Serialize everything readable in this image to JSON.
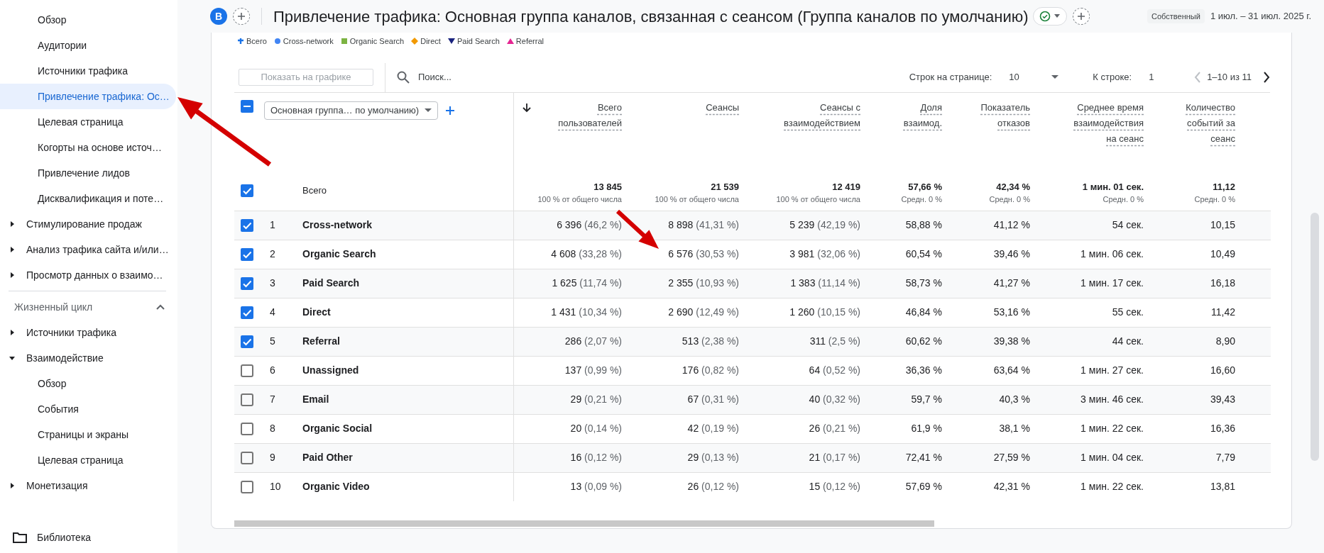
{
  "sidebar": {
    "items": [
      {
        "kind": "leaf",
        "label": "Обзор",
        "selected": false
      },
      {
        "kind": "leaf",
        "label": "Аудитории",
        "selected": false
      },
      {
        "kind": "leaf",
        "label": "Источники трафика",
        "selected": false
      },
      {
        "kind": "leaf",
        "label": "Привлечение трафика: Ос…",
        "selected": true
      },
      {
        "kind": "leaf",
        "label": "Целевая страница",
        "selected": false
      },
      {
        "kind": "leaf",
        "label": "Когорты на основе источ…",
        "selected": false
      },
      {
        "kind": "leaf",
        "label": "Привлечение лидов",
        "selected": false
      },
      {
        "kind": "leaf",
        "label": "Дисквалификация и поте…",
        "selected": false
      },
      {
        "kind": "group",
        "label": "Стимулирование продаж",
        "selected": false,
        "expanded": false
      },
      {
        "kind": "group",
        "label": "Анализ трафика сайта и/или…",
        "selected": false,
        "expanded": false
      },
      {
        "kind": "group",
        "label": "Просмотр данных о взаимо…",
        "selected": false,
        "expanded": false
      },
      {
        "kind": "section",
        "label": "Жизненный цикл",
        "selected": false,
        "expanded": true,
        "children": [
          {
            "kind": "group",
            "label": "Источники трафика",
            "selected": false,
            "expanded": false
          },
          {
            "kind": "group",
            "label": "Взаимодействие",
            "selected": false,
            "expanded": true,
            "children": [
              {
                "kind": "leaf",
                "label": "Обзор",
                "selected": false
              },
              {
                "kind": "leaf",
                "label": "События",
                "selected": false
              },
              {
                "kind": "leaf",
                "label": "Страницы и экраны",
                "selected": false
              },
              {
                "kind": "leaf",
                "label": "Целевая страница",
                "selected": false
              }
            ]
          },
          {
            "kind": "group",
            "label": "Монетизация",
            "selected": false,
            "expanded": false
          }
        ]
      }
    ],
    "footer": {
      "label": "Библиотека"
    }
  },
  "header": {
    "avatar": "B",
    "title": "Привлечение трафика: Основная группа каналов, связанная с сеансом (Группа каналов по умолчанию)",
    "badge": "Собственный",
    "date_range": "1 июл. – 31 июл. 2025 г."
  },
  "legend": [
    {
      "label": "Всего",
      "kind": "pin",
      "color": "#1a73e8"
    },
    {
      "label": "Cross-network",
      "kind": "circle",
      "color": "#4285f4"
    },
    {
      "label": "Organic Search",
      "kind": "square",
      "color": "#7cb342"
    },
    {
      "label": "Direct",
      "kind": "diamond",
      "color": "#f29900"
    },
    {
      "label": "Paid Search",
      "kind": "triangle-down",
      "color": "#1a237e"
    },
    {
      "label": "Referral",
      "kind": "triangle-up",
      "color": "#e52592"
    }
  ],
  "toolbar": {
    "plot_button": {
      "label": "Показать на графике",
      "disabled": true
    },
    "search": {
      "placeholder": "Поиск..."
    },
    "rows_per_page_label": "Строк на странице:",
    "rows_per_page": "10",
    "goto_label": "К строке:",
    "goto_value": "1",
    "range": "1–10 из 11",
    "prev_disabled": true,
    "next_disabled": false
  },
  "table": {
    "header_checkbox": {
      "indeterminate": true
    },
    "dimension": "Основная группа… по умолчанию)",
    "columns": [
      "Всего пользователей",
      "Сеансы",
      "Сеансы с взаимодействием",
      "Доля взаимод.",
      "Показатель отказов",
      "Среднее время взаимодействия на сеанс",
      "Количество событий за сеанс"
    ],
    "totals": {
      "label": "Всего",
      "checked": true,
      "cells": [
        {
          "value": "13 845",
          "note": "100 % от общего числа"
        },
        {
          "value": "21 539",
          "note": "100 % от общего числа"
        },
        {
          "value": "12 419",
          "note": "100 % от общего числа"
        },
        {
          "value": "57,66 %",
          "note": "Средн. 0 %"
        },
        {
          "value": "42,34 %",
          "note": "Средн. 0 %"
        },
        {
          "value": "1 мин. 01 сек.",
          "note": "Средн. 0 %"
        },
        {
          "value": "11,12",
          "note": "Средн. 0 %"
        }
      ]
    },
    "rows": [
      {
        "n": "1",
        "channel": "Cross-network",
        "checked": true,
        "cells": [
          {
            "value": "6 396",
            "share": "(46,2 %)"
          },
          {
            "value": "8 898",
            "share": "(41,31 %)"
          },
          {
            "value": "5 239",
            "share": "(42,19 %)"
          },
          {
            "value": "58,88 %"
          },
          {
            "value": "41,12 %"
          },
          {
            "value": "54 сек."
          },
          {
            "value": "10,15"
          }
        ]
      },
      {
        "n": "2",
        "channel": "Organic Search",
        "checked": true,
        "cells": [
          {
            "value": "4 608",
            "share": "(33,28 %)"
          },
          {
            "value": "6 576",
            "share": "(30,53 %)"
          },
          {
            "value": "3 981",
            "share": "(32,06 %)"
          },
          {
            "value": "60,54 %"
          },
          {
            "value": "39,46 %"
          },
          {
            "value": "1 мин. 06 сек."
          },
          {
            "value": "10,49"
          }
        ]
      },
      {
        "n": "3",
        "channel": "Paid Search",
        "checked": true,
        "cells": [
          {
            "value": "1 625",
            "share": "(11,74 %)"
          },
          {
            "value": "2 355",
            "share": "(10,93 %)"
          },
          {
            "value": "1 383",
            "share": "(11,14 %)"
          },
          {
            "value": "58,73 %"
          },
          {
            "value": "41,27 %"
          },
          {
            "value": "1 мин. 17 сек."
          },
          {
            "value": "16,18"
          }
        ]
      },
      {
        "n": "4",
        "channel": "Direct",
        "checked": true,
        "cells": [
          {
            "value": "1 431",
            "share": "(10,34 %)"
          },
          {
            "value": "2 690",
            "share": "(12,49 %)"
          },
          {
            "value": "1 260",
            "share": "(10,15 %)"
          },
          {
            "value": "46,84 %"
          },
          {
            "value": "53,16 %"
          },
          {
            "value": "55 сек."
          },
          {
            "value": "11,42"
          }
        ]
      },
      {
        "n": "5",
        "channel": "Referral",
        "checked": true,
        "cells": [
          {
            "value": "286",
            "share": "(2,07 %)"
          },
          {
            "value": "513",
            "share": "(2,38 %)"
          },
          {
            "value": "311",
            "share": "(2,5 %)"
          },
          {
            "value": "60,62 %"
          },
          {
            "value": "39,38 %"
          },
          {
            "value": "44 сек."
          },
          {
            "value": "8,90"
          }
        ]
      },
      {
        "n": "6",
        "channel": "Unassigned",
        "checked": false,
        "cells": [
          {
            "value": "137",
            "share": "(0,99 %)"
          },
          {
            "value": "176",
            "share": "(0,82 %)"
          },
          {
            "value": "64",
            "share": "(0,52 %)"
          },
          {
            "value": "36,36 %"
          },
          {
            "value": "63,64 %"
          },
          {
            "value": "1 мин. 27 сек."
          },
          {
            "value": "16,60"
          }
        ]
      },
      {
        "n": "7",
        "channel": "Email",
        "checked": false,
        "cells": [
          {
            "value": "29",
            "share": "(0,21 %)"
          },
          {
            "value": "67",
            "share": "(0,31 %)"
          },
          {
            "value": "40",
            "share": "(0,32 %)"
          },
          {
            "value": "59,7 %"
          },
          {
            "value": "40,3 %"
          },
          {
            "value": "3 мин. 46 сек."
          },
          {
            "value": "39,43"
          }
        ]
      },
      {
        "n": "8",
        "channel": "Organic Social",
        "checked": false,
        "cells": [
          {
            "value": "20",
            "share": "(0,14 %)"
          },
          {
            "value": "42",
            "share": "(0,19 %)"
          },
          {
            "value": "26",
            "share": "(0,21 %)"
          },
          {
            "value": "61,9 %"
          },
          {
            "value": "38,1 %"
          },
          {
            "value": "1 мин. 22 сек."
          },
          {
            "value": "16,36"
          }
        ]
      },
      {
        "n": "9",
        "channel": "Paid Other",
        "checked": false,
        "cells": [
          {
            "value": "16",
            "share": "(0,12 %)"
          },
          {
            "value": "29",
            "share": "(0,13 %)"
          },
          {
            "value": "21",
            "share": "(0,17 %)"
          },
          {
            "value": "72,41 %"
          },
          {
            "value": "27,59 %"
          },
          {
            "value": "1 мин. 04 сек."
          },
          {
            "value": "7,79"
          }
        ]
      },
      {
        "n": "10",
        "channel": "Organic Video",
        "checked": false,
        "cells": [
          {
            "value": "13",
            "share": "(0,09 %)"
          },
          {
            "value": "26",
            "share": "(0,12 %)"
          },
          {
            "value": "15",
            "share": "(0,12 %)"
          },
          {
            "value": "57,69 %"
          },
          {
            "value": "42,31 %"
          },
          {
            "value": "1 мин. 22 сек."
          },
          {
            "value": "13,81"
          }
        ]
      }
    ]
  }
}
